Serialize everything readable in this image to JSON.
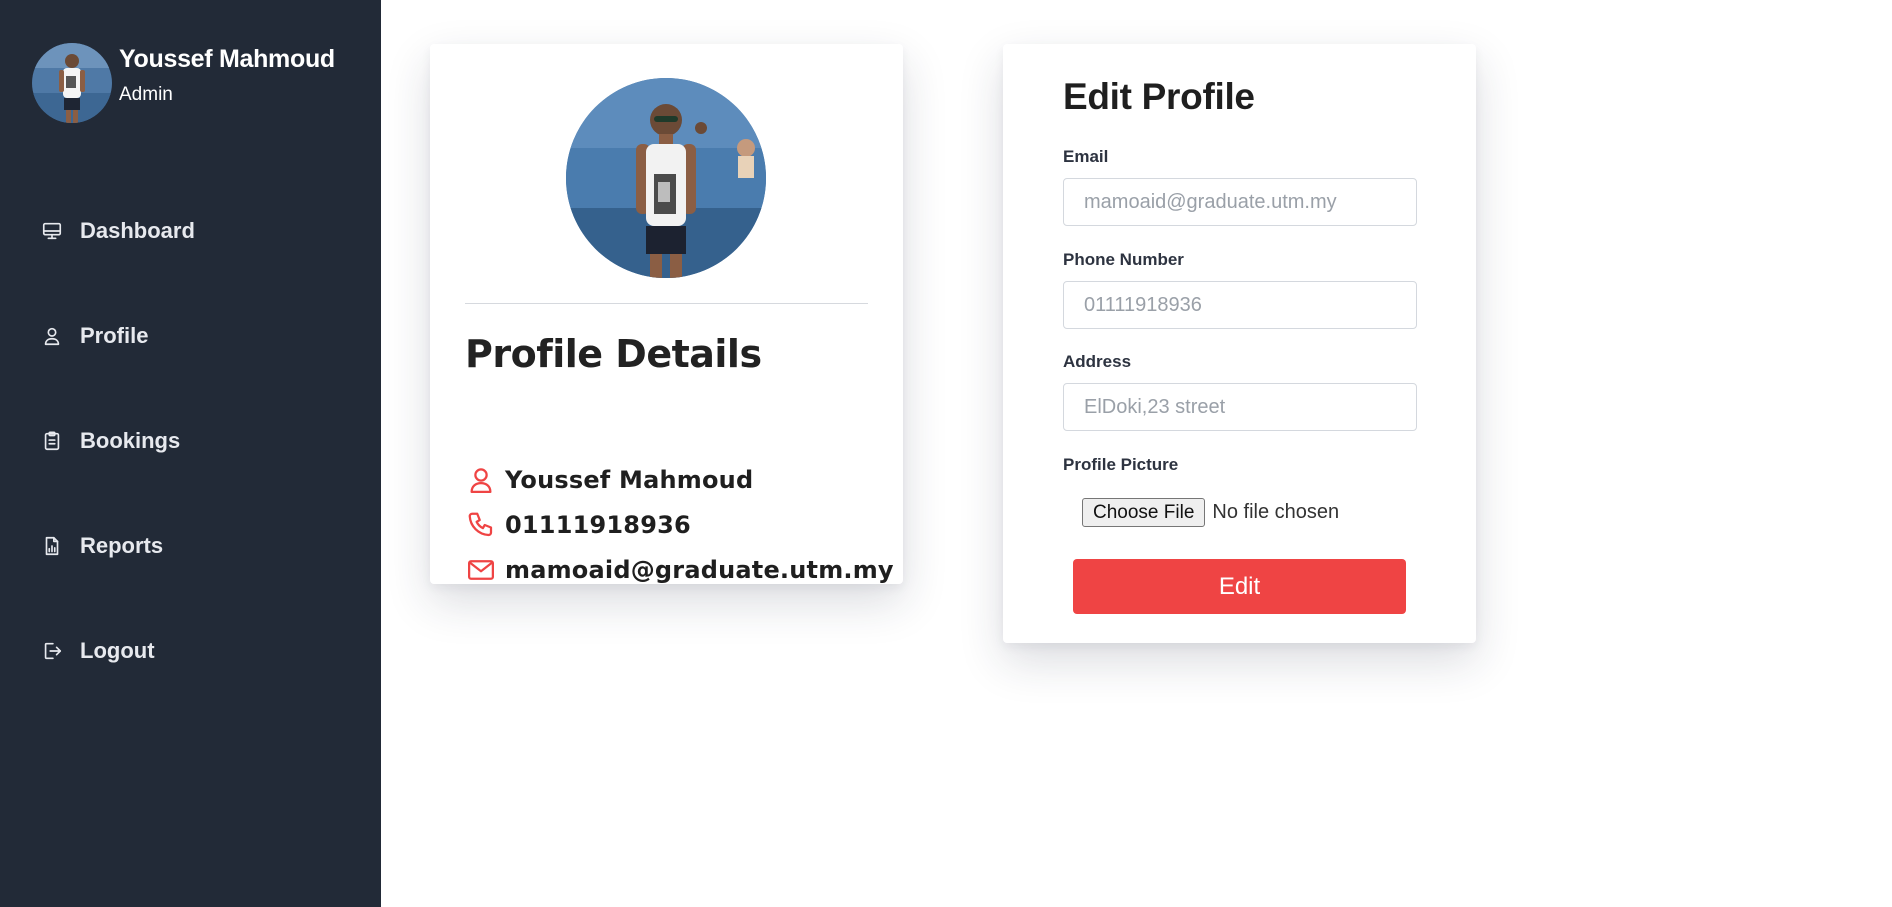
{
  "user": {
    "name": "Youssef Mahmoud",
    "role": "Admin"
  },
  "sidebar": {
    "items": [
      {
        "label": "Dashboard",
        "icon": "monitor-icon"
      },
      {
        "label": "Profile",
        "icon": "user-icon"
      },
      {
        "label": "Bookings",
        "icon": "clipboard-icon"
      },
      {
        "label": "Reports",
        "icon": "report-icon"
      },
      {
        "label": "Logout",
        "icon": "logout-icon"
      }
    ]
  },
  "profile_card": {
    "title": "Profile Details",
    "name": "Youssef Mahmoud",
    "phone": "01111918936",
    "email": "mamoaid@graduate.utm.my"
  },
  "edit_profile": {
    "title": "Edit Profile",
    "email_label": "Email",
    "email_placeholder": "mamoaid@graduate.utm.my",
    "phone_label": "Phone Number",
    "phone_placeholder": "01111918936",
    "address_label": "Address",
    "address_placeholder": "ElDoki,23 street",
    "picture_label": "Profile Picture",
    "choose_file_label": "Choose File",
    "file_status": "No file chosen",
    "submit_label": "Edit"
  },
  "colors": {
    "sidebar_bg": "#222a37",
    "accent": "#ef4444",
    "icon_red": "#ef4444"
  }
}
